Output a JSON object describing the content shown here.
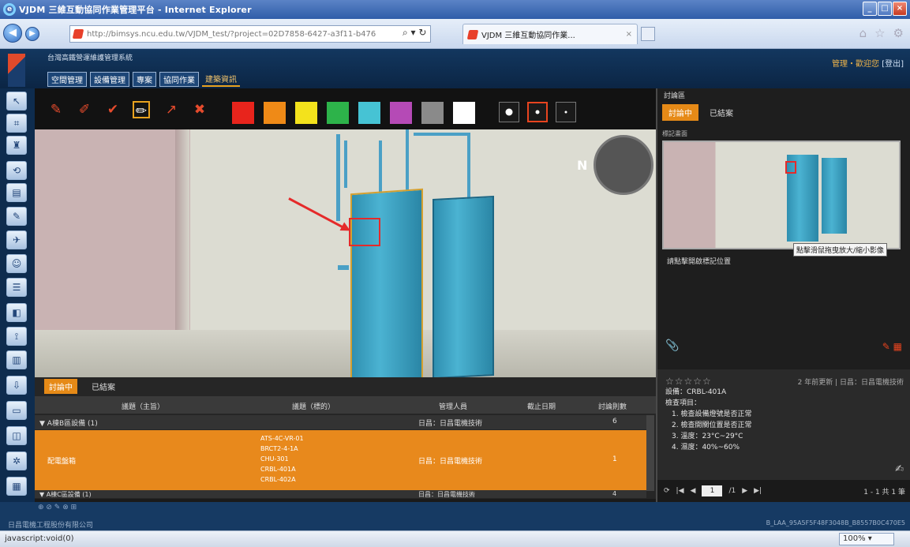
{
  "browser": {
    "title": "VJDM 三維互動協同作業管理平台 - Internet Explorer",
    "address": "http://bimsys.ncu.edu.tw/VJDM_test/?project=02D7858-6427-a3f11-b476",
    "tab_label": "VJDM 三維互動協同作業...",
    "zoom": "100%",
    "status_text": "javascript:void(0)"
  },
  "app": {
    "org_name": "台灣高鐵營運維護管理系統",
    "menu": [
      "空間管理",
      "設備管理",
      "專案",
      "協同作業",
      "建築資訊"
    ],
    "active_menu_index": 4,
    "user": "管理・歡迎您",
    "logout": "[登出]"
  },
  "viewer": {
    "colors": [
      "#e8241c",
      "#ef8a17",
      "#f3e21c",
      "#2db34a",
      "#46c3d4",
      "#b54ab6",
      "#8a8a8a",
      "#ffffff"
    ],
    "compass_label": "N"
  },
  "issues_table": {
    "tabs": [
      "討論中",
      "已結案"
    ],
    "columns": [
      "議題（主旨）",
      "議題（標的）",
      "管理人員",
      "截止日期",
      "討論則數"
    ],
    "groups": [
      {
        "label": "▼ A棟B區設備 (1)",
        "manager": "日昌：日昌電機技術",
        "count": "6"
      },
      {
        "label": "▼ A棟C區設備 (1)",
        "manager": "日昌：日昌電機技術",
        "count": "4"
      }
    ],
    "selected_row": {
      "subject": "配電盤箱",
      "targets": [
        "ATS-4C-VR-01",
        "BRCT2-4-1A",
        "CHU-301",
        "CRBL-401A",
        "CRBL-402A"
      ],
      "manager": "日昌：日昌電機技術",
      "count": "1"
    }
  },
  "discussion": {
    "title": "討論區",
    "tabs": [
      "討論中",
      "已結案"
    ],
    "subtitle": "標記畫面",
    "tooltip": "點擊滑鼠拖曳放大/縮小影像",
    "caption": "請點擊開啟標記位置",
    "stars": "☆☆☆☆☆",
    "meta": "2 年前更新 | 日昌：日昌電機技術",
    "details": [
      "設備：CRBL-401A",
      "檢查項目：",
      "1. 檢查設備燈號是否正常",
      "2. 檢查開關位置是否正常",
      "3. 溫度：23°C~29°C",
      "4. 濕度：40%~60%"
    ],
    "page": "1",
    "page_total": "/1",
    "count_text": "1 - 1 共 1 筆"
  },
  "footer": {
    "company": "日昌電機工程股份有限公司",
    "right": "B_LAA_95A5F5F48F3048B_B8557B0C470E5"
  }
}
